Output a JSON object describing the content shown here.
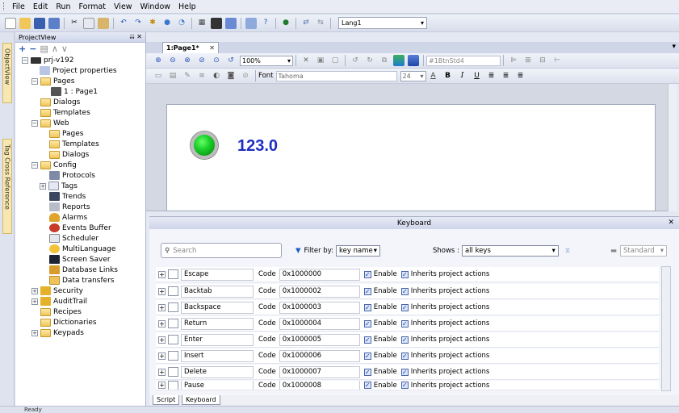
{
  "menu": [
    "File",
    "Edit",
    "Run",
    "Format",
    "View",
    "Window",
    "Help"
  ],
  "toolbar": {
    "language": "Lang1"
  },
  "side_tabs": {
    "object_view": "ObjectView",
    "tag_xref": "Tag Cross Reference"
  },
  "project_view": {
    "title": "ProjectView",
    "pin": "⮇ ✕",
    "tree": [
      {
        "label": "prj-v192"
      },
      {
        "label": "Project properties"
      },
      {
        "label": "Pages"
      },
      {
        "label": "1 : Page1"
      },
      {
        "label": "Dialogs"
      },
      {
        "label": "Templates"
      },
      {
        "label": "Web"
      },
      {
        "label": "Pages"
      },
      {
        "label": "Templates"
      },
      {
        "label": "Dialogs"
      },
      {
        "label": "Config"
      },
      {
        "label": "Protocols"
      },
      {
        "label": "Tags"
      },
      {
        "label": "Trends"
      },
      {
        "label": "Reports"
      },
      {
        "label": "Alarms"
      },
      {
        "label": "Events Buffer"
      },
      {
        "label": "Scheduler"
      },
      {
        "label": "MultiLanguage"
      },
      {
        "label": "Screen Saver"
      },
      {
        "label": "Database Links"
      },
      {
        "label": "Data transfers"
      },
      {
        "label": "Security"
      },
      {
        "label": "AuditTrail"
      },
      {
        "label": "Recipes"
      },
      {
        "label": "Dictionaries"
      },
      {
        "label": "Keypads"
      }
    ]
  },
  "editor": {
    "tab": "1:Page1*",
    "zoom": "100%",
    "style": "#1BtnStd4",
    "font_label": "Font",
    "font": "Tahoma",
    "font_size": "24",
    "display_value": "123.0"
  },
  "keyboard": {
    "title": "Keyboard",
    "search_placeholder": "Search",
    "filter_label": "Filter by:",
    "filter_value": "key name",
    "shows_label": "Shows :",
    "shows_value": "all keys",
    "standard": "Standard",
    "code_label": "Code",
    "enable_label": "Enable",
    "inherits_label": "Inherits project actions",
    "rows": [
      {
        "name": "Escape",
        "code": "0x1000000"
      },
      {
        "name": "Backtab",
        "code": "0x1000002"
      },
      {
        "name": "Backspace",
        "code": "0x1000003"
      },
      {
        "name": "Return",
        "code": "0x1000004"
      },
      {
        "name": "Enter",
        "code": "0x1000005"
      },
      {
        "name": "Insert",
        "code": "0x1000006"
      },
      {
        "name": "Delete",
        "code": "0x1000007"
      },
      {
        "name": "Pause",
        "code": "0x1000008"
      }
    ]
  },
  "bottom_tabs": [
    "Script",
    "Keyboard"
  ],
  "status": "Ready"
}
